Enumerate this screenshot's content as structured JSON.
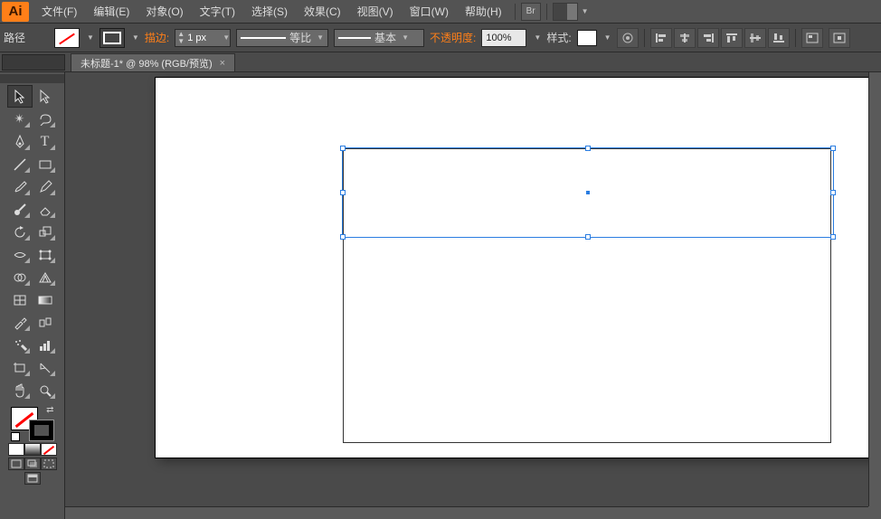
{
  "app": {
    "logo": "Ai"
  },
  "menu": {
    "file": "文件(F)",
    "edit": "编辑(E)",
    "object": "对象(O)",
    "type": "文字(T)",
    "select": "选择(S)",
    "effect": "效果(C)",
    "view": "视图(V)",
    "window": "窗口(W)",
    "help": "帮助(H)"
  },
  "bridge_btn": "Br",
  "control": {
    "object_label": "路径",
    "stroke_label": "描边:",
    "stroke_weight": "1 px",
    "profile_label": "等比",
    "brush_label": "基本",
    "opacity_label": "不透明度:",
    "opacity_value": "100%",
    "style_label": "样式:"
  },
  "tab": {
    "title": "未标题-1* @ 98% (RGB/预览)",
    "close": "×"
  },
  "tools": {
    "selection": "selection-tool",
    "direct": "direct-selection-tool",
    "magic_wand": "magic-wand-tool",
    "lasso": "lasso-tool",
    "pen": "pen-tool",
    "type": "type-tool",
    "line": "line-segment-tool",
    "rectangle": "rectangle-tool",
    "paintbrush": "paintbrush-tool",
    "pencil": "pencil-tool",
    "blob": "blob-brush-tool",
    "eraser": "eraser-tool",
    "rotate": "rotate-tool",
    "scale": "scale-tool",
    "width": "width-tool",
    "free_transform": "free-transform-tool",
    "shape_builder": "shape-builder-tool",
    "perspective": "perspective-grid-tool",
    "mesh": "mesh-tool",
    "gradient": "gradient-tool",
    "eyedropper": "eyedropper-tool",
    "blend": "blend-tool",
    "symbol": "symbol-sprayer-tool",
    "graph": "column-graph-tool",
    "artboard": "artboard-tool",
    "slice": "slice-tool",
    "hand": "hand-tool",
    "zoom": "zoom-tool"
  },
  "colors": {
    "accent": "#ff7f18",
    "selection": "#2a7de1"
  }
}
